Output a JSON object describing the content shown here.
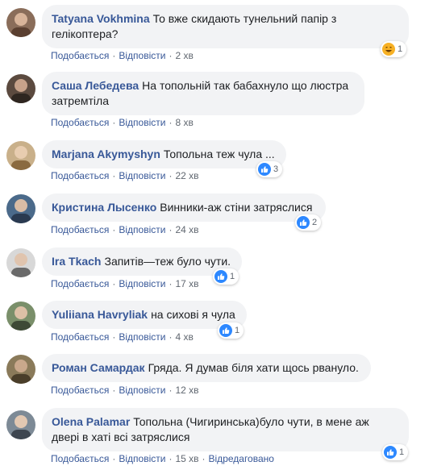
{
  "labels": {
    "like": "Подобається",
    "reply": "Відповісти",
    "dot": "·",
    "edited": "Відредаговано"
  },
  "colors": {
    "like_blue": "#2d88ff",
    "haha_yellow": "#f7b125",
    "link": "#385898",
    "bubble": "#f2f3f5"
  },
  "comments": [
    {
      "author": "Tatyana Vokhmina",
      "text": "То вже скидають тунельний папір з гелікоптера?",
      "time": "2 хв",
      "reaction_icon": "haha-icon",
      "reaction_count": "1",
      "avatar_color": "#8a6d5a"
    },
    {
      "author": "Саша Лебедева",
      "text": "На топольній так бабахнуло що люстра затремтіла",
      "time": "8 хв",
      "avatar_color": "#5b4a3f"
    },
    {
      "author": "Marjana Akymyshyn",
      "text": "Топольна теж чула ...",
      "time": "22 хв",
      "reaction_icon": "like-icon",
      "reaction_count": "3",
      "avatar_color": "#c9b08a"
    },
    {
      "author": "Кристина Лысенко",
      "text": "Винники-аж стіни затряслися",
      "time": "24 хв",
      "reaction_icon": "like-icon",
      "reaction_count": "2",
      "avatar_color": "#4b6a8a"
    },
    {
      "author": "Ira Tkach",
      "text": "Запитів—теж було чути.",
      "time": "17 хв",
      "reaction_icon": "like-icon",
      "reaction_count": "1",
      "avatar_color": "#9a9a9a"
    },
    {
      "author": "Yuliiana Havryliak",
      "text": "на сихові я чула",
      "time": "4 хв",
      "reaction_icon": "like-icon",
      "reaction_count": "1",
      "avatar_color": "#7a8f6a"
    },
    {
      "author": "Роман Самардак",
      "text": "Гряда. Я думав біля хати щось рвануло.",
      "time": "12 хв",
      "avatar_color": "#8a7a5a"
    },
    {
      "author": "Olena Palamar",
      "text": "Топольна (Чигиринська)було чути, в мене аж двері в хаті всі затряслися",
      "time": "15 хв",
      "edited": true,
      "reaction_icon": "like-icon",
      "reaction_count": "1",
      "avatar_color": "#7d8a96"
    }
  ]
}
